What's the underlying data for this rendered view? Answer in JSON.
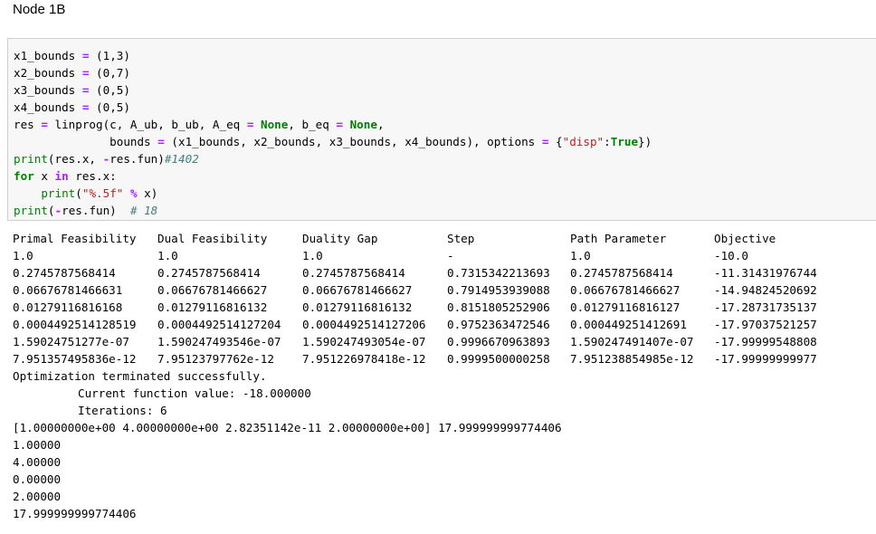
{
  "heading": "Node 1B",
  "code": {
    "line1": {
      "name": "x1_bounds",
      "eq": "=",
      "val": "(1,3)"
    },
    "line2": {
      "name": "x2_bounds",
      "eq": "=",
      "val": "(0,7)"
    },
    "line3": {
      "name": "x3_bounds",
      "eq": "=",
      "val": "(0,5)"
    },
    "line4": {
      "name": "x4_bounds",
      "eq": "=",
      "val": "(0,5)"
    },
    "line5": {
      "a": "res ",
      "eq1": "=",
      "b": " linprog(c, A_ub, b_ub, A_eq ",
      "eq2": "=",
      "none1": " None",
      "c": ", b_eq ",
      "eq3": "=",
      "none2": " None",
      "d": ","
    },
    "line6": {
      "a": "              bounds ",
      "eq1": "=",
      "b": " (x1_bounds, x2_bounds, x3_bounds, x4_bounds), options ",
      "eq2": "=",
      "c": " {",
      "str": "\"disp\"",
      "d": ":",
      "true": "True",
      "e": "})"
    },
    "line7": {
      "print": "print",
      "a": "(res.x, ",
      "minus": "-",
      "b": "res.fun)",
      "comment": "#1402"
    },
    "line8": {
      "for": "for",
      "a": " x ",
      "in": "in",
      "b": " res.x:"
    },
    "line9": {
      "indent": "    ",
      "print": "print",
      "a": "(",
      "str": "\"%.5f\"",
      "b": " ",
      "pct": "%",
      "c": " x)"
    },
    "line10": {
      "print": "print",
      "a": "(",
      "minus": "-",
      "b": "res.fun)  ",
      "comment": "# 18"
    }
  },
  "output": {
    "headers": [
      "Primal Feasibility",
      "Dual Feasibility",
      "Duality Gap",
      "Step",
      "Path Parameter",
      "Objective"
    ],
    "rows": [
      [
        "1.0",
        "1.0",
        "1.0",
        "-",
        "1.0",
        "-10.0"
      ],
      [
        "0.2745787568414",
        "0.2745787568414",
        "0.2745787568414",
        "0.7315342213693",
        "0.2745787568414",
        "-11.31431976744"
      ],
      [
        "0.06676781466631",
        "0.06676781466627",
        "0.06676781466627",
        "0.7914953939088",
        "0.06676781466627",
        "-14.94824520692"
      ],
      [
        "0.01279116816168",
        "0.01279116816132",
        "0.01279116816132",
        "0.8151805252906",
        "0.01279116816127",
        "-17.28731735137"
      ],
      [
        "0.0004492514128519",
        "0.0004492514127204",
        "0.0004492514127206",
        "0.9752363472546",
        "0.000449251412691",
        "-17.97037521257"
      ],
      [
        "1.59024751277e-07",
        "1.590247493546e-07",
        "1.590247493054e-07",
        "0.9996670963893",
        "1.590247491407e-07",
        "-17.99999548808"
      ],
      [
        "7.951357495836e-12",
        "7.95123797762e-12",
        "7.951226978418e-12",
        "0.9999500000258",
        "7.951238854985e-12",
        "-17.99999999977"
      ]
    ],
    "terminated": "Optimization terminated successfully.",
    "current_value": "Current function value: -18.000000",
    "iterations": "Iterations: 6",
    "result_line": "[1.00000000e+00 4.00000000e+00 2.82351142e-11 2.00000000e+00] 17.999999999774406",
    "values": [
      "1.00000",
      "4.00000",
      "0.00000",
      "2.00000"
    ],
    "final": "17.999999999774406"
  }
}
